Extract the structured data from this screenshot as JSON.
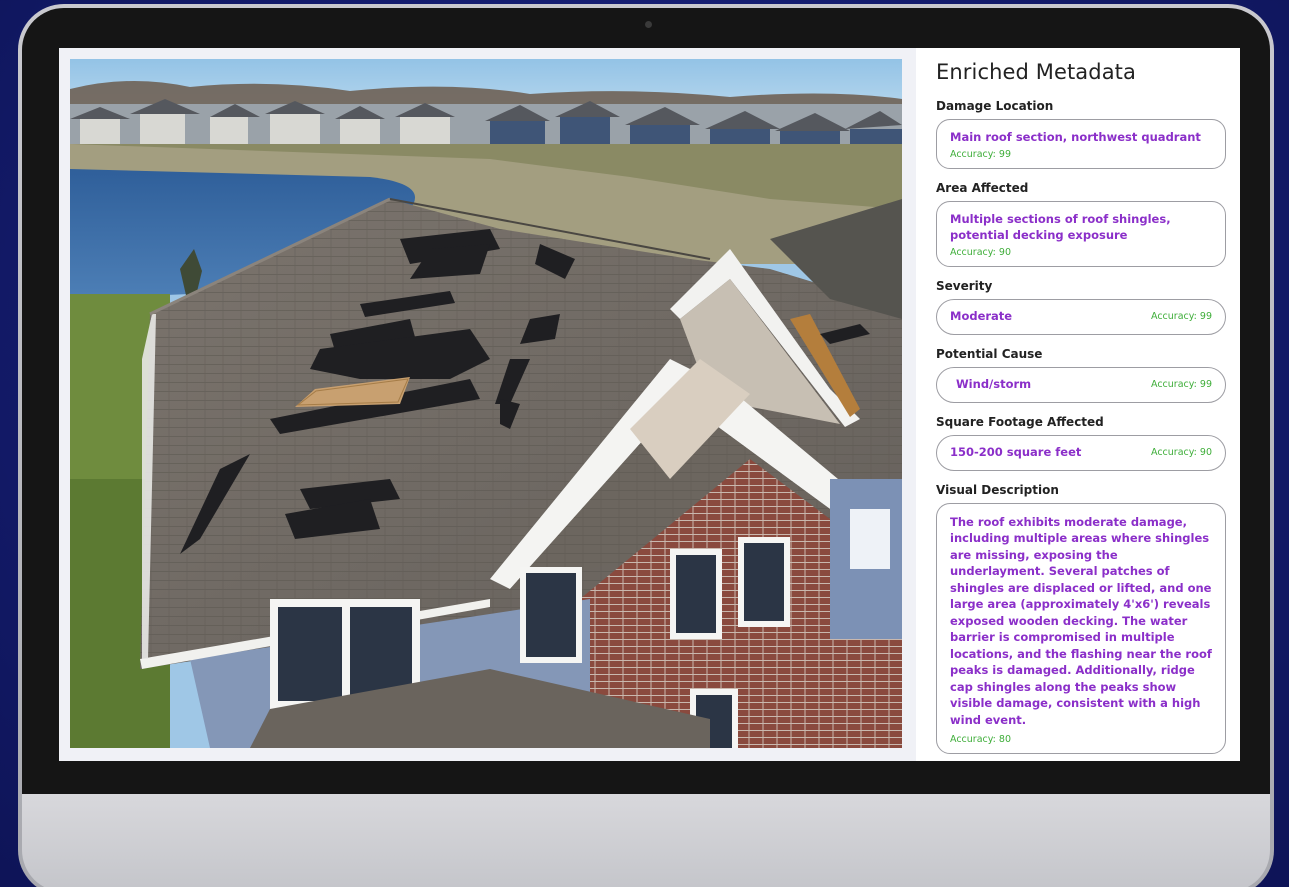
{
  "panel": {
    "title": "Enriched Metadata",
    "fields": [
      {
        "label": "Damage Location",
        "value": "Main roof section, northwest quadrant",
        "accuracy": "Accuracy: 99"
      },
      {
        "label": "Area Affected",
        "value": "Multiple sections of roof shingles, potential decking exposure",
        "accuracy": "Accuracy: 90"
      },
      {
        "label": "Severity",
        "value": "Moderate",
        "accuracy": "Accuracy: 99"
      },
      {
        "label": "Potential Cause",
        "value": "Wind/storm",
        "accuracy": "Accuracy: 99"
      },
      {
        "label": "Square Footage Affected",
        "value": "150-200 square feet",
        "accuracy": "Accuracy: 90"
      },
      {
        "label": "Visual Description",
        "value": "The roof exhibits moderate damage, including multiple areas where shingles are missing, exposing the underlayment. Several patches of shingles are displaced or lifted, and one large area (approximately 4'x6') reveals exposed wooden decking. The water barrier is compromised in multiple locations, and the flashing near the roof peaks is damaged. Additionally, ridge cap shingles along the peaks show visible damage, consistent with a high wind event.",
        "accuracy": "Accuracy: 80"
      }
    ]
  },
  "colors": {
    "background": "#141c6e",
    "value_text": "#8b2fc9",
    "accuracy_text": "#3fae3a"
  },
  "icons": {
    "camera": "webcam-icon"
  }
}
